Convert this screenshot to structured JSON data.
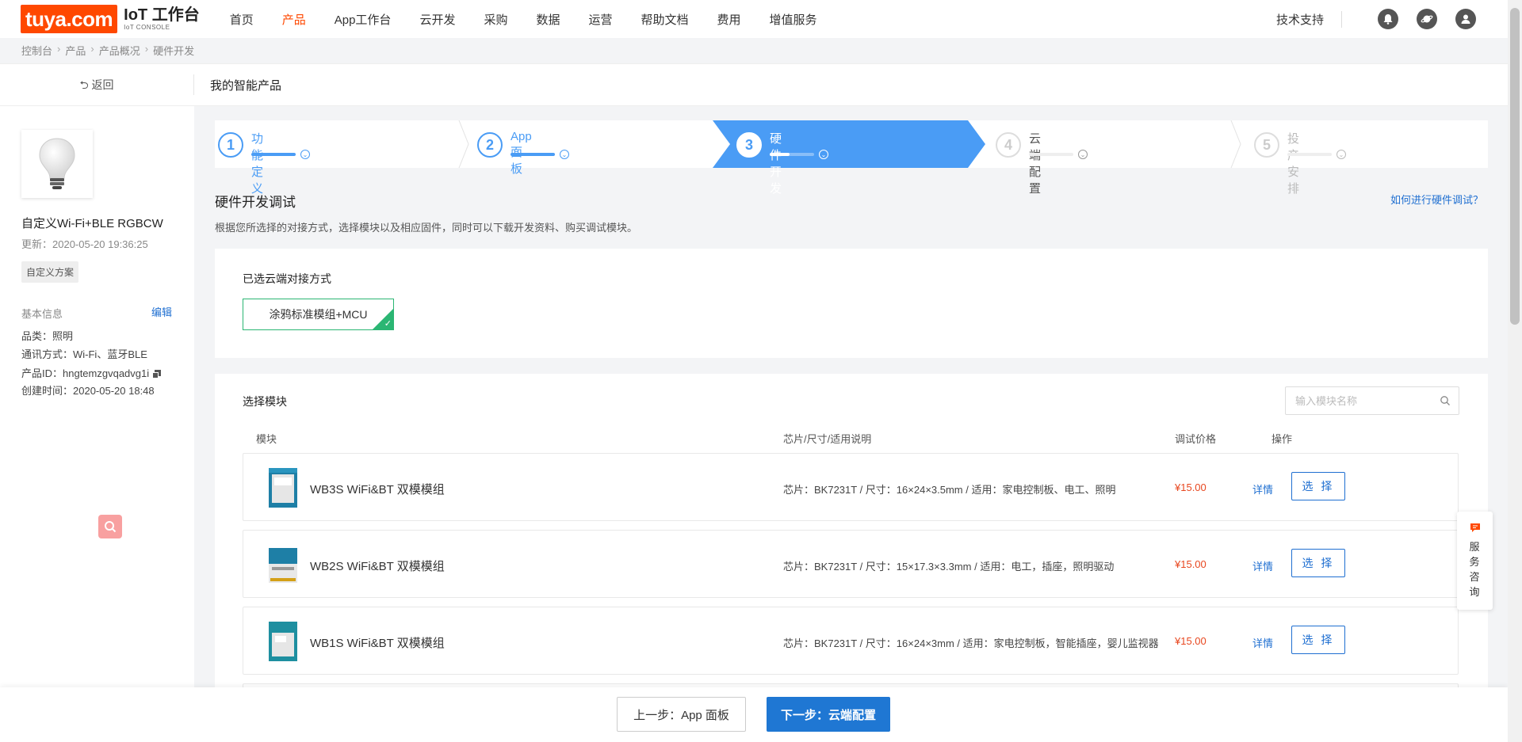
{
  "brand": {
    "logo": "tuya.com",
    "title": "IoT 工作台",
    "subtitle": "IoT CONSOLE"
  },
  "nav": {
    "items": [
      "首页",
      "产品",
      "App工作台",
      "云开发",
      "采购",
      "数据",
      "运营",
      "帮助文档",
      "费用",
      "增值服务"
    ],
    "active": "产品"
  },
  "topright": {
    "support": "技术支持"
  },
  "breadcrumb": [
    "控制台",
    "产品",
    "产品概况",
    "硬件开发"
  ],
  "backbar": {
    "back_label": "返回",
    "title": "我的智能产品"
  },
  "product": {
    "name": "自定义Wi-Fi+BLE RGBCW",
    "updated": "更新：2020-05-20 19:36:25",
    "tag": "自定义方案",
    "basic_label": "基本信息",
    "edit_label": "编辑",
    "category": "品类：照明",
    "protocol": "通讯方式：Wi-Fi、蓝牙BLE",
    "pid": "产品ID：hngtemzgvqadvg1i",
    "created": "创建时间：2020-05-20 18:48"
  },
  "steps": [
    {
      "num": "1",
      "label": "功能定义",
      "progress": 1.0
    },
    {
      "num": "2",
      "label": "App 面板",
      "progress": 1.0
    },
    {
      "num": "3",
      "label": "硬件开发",
      "progress": 0.45
    },
    {
      "num": "4",
      "label": "云端配置",
      "progress": 0
    },
    {
      "num": "5",
      "label": "投产安排",
      "progress": 0
    }
  ],
  "section": {
    "title": "硬件开发调试",
    "help": "如何进行硬件调试？",
    "desc": "根据您所选择的对接方式，选择模块以及相应固件，同时可以下载开发资料、购买调试模块。"
  },
  "method": {
    "label": "已选云端对接方式",
    "value": "涂鸦标准模组+MCU"
  },
  "modules": {
    "label": "选择模块",
    "search_placeholder": "输入模块名称",
    "headers": {
      "module": "模块",
      "spec": "芯片/尺寸/适用说明",
      "price": "调试价格",
      "action": "操作"
    },
    "detail_label": "详情",
    "select_label": "选 择",
    "rows": [
      {
        "name": "WB3S WiFi&BT 双模模组",
        "spec": "芯片：BK7231T / 尺寸：16×24×3.5mm / 适用：家电控制板、电工、照明",
        "price": "¥15.00"
      },
      {
        "name": "WB2S WiFi&BT 双模模组",
        "spec": "芯片：BK7231T / 尺寸：15×17.3×3.3mm / 适用：电工，插座，照明驱动",
        "price": "¥15.00"
      },
      {
        "name": "WB1S WiFi&BT 双模模组",
        "spec": "芯片：BK7231T / 尺寸：16×24×3mm / 适用：家电控制板，智能插座，婴儿监视器",
        "price": "¥15.00"
      }
    ]
  },
  "footer": {
    "prev": "上一步：App 面板",
    "next": "下一步：云端配置"
  },
  "service": {
    "text": "服务咨询"
  },
  "colors": {
    "brand": "#ff4800",
    "primary": "#1f77d3",
    "step_active": "#4a9cf5",
    "ok": "#2bb673",
    "price": "#e8471f"
  }
}
